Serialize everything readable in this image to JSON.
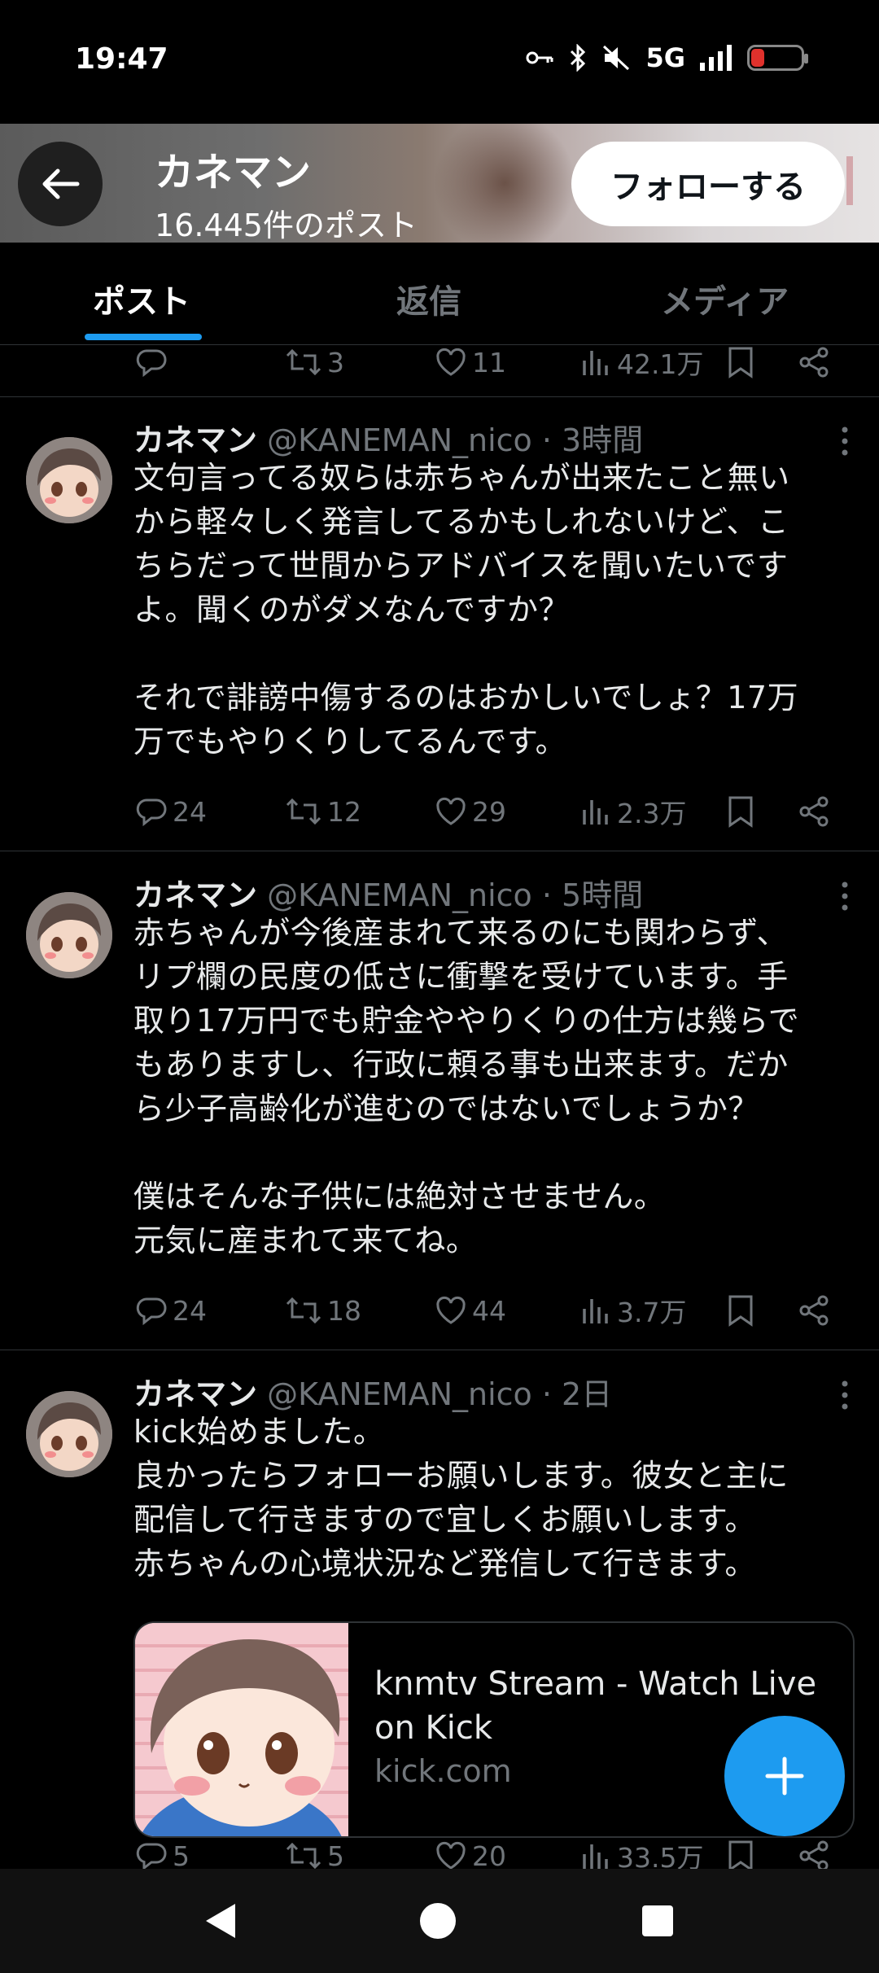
{
  "status_bar": {
    "time": "19:47",
    "network": "5G"
  },
  "header": {
    "name": "カネマン",
    "post_count": "16.445件のポスト",
    "follow_label": "フォローする"
  },
  "tabs": [
    {
      "label": "ポスト"
    },
    {
      "label": "返信"
    },
    {
      "label": "メディア"
    }
  ],
  "partial_post": {
    "retweets": "3",
    "likes": "11",
    "views": "42.1万"
  },
  "posts": [
    {
      "name": "カネマン",
      "handle": "@KANEMAN_nico",
      "time": "3時間",
      "meta": "@KANEMAN_nico · 3時間",
      "text": "文句言ってる奴らは赤ちゃんが出来たこと無い\nから軽々しく発言してるかもしれないけど、こ\nちらだって世間からアドバイスを聞いたいです\nよ。聞くのがダメなんですか？\n\nそれで誹謗中傷するのはおかしいでしょ？17万\n万でもやりくりしてるんです。",
      "replies": "24",
      "retweets": "12",
      "likes": "29",
      "views": "2.3万"
    },
    {
      "name": "カネマン",
      "handle": "@KANEMAN_nico",
      "time": "5時間",
      "meta": "@KANEMAN_nico · 5時間",
      "text": "赤ちゃんが今後産まれて来るのにも関わらず、\nリプ欄の民度の低さに衝撃を受けています。手\n取り17万円でも貯金ややりくりの仕方は幾らで\nもありますし、行政に頼る事も出来ます。だか\nら少子高齢化が進むのではないでしょうか？\n\n僕はそんな子供には絶対させません。\n元気に産まれて来てね。",
      "replies": "24",
      "retweets": "18",
      "likes": "44",
      "views": "3.7万"
    },
    {
      "name": "カネマン",
      "handle": "@KANEMAN_nico",
      "time": "2日",
      "meta": "@KANEMAN_nico · 2日",
      "text": "kick始めました。\n良かったらフォローお願いします。彼女と主に\n配信して行きますので宜しくお願いします。\n赤ちゃんの心境状況など発信して行きます。",
      "card": {
        "title": "knmtv Stream - Watch Live on Kick",
        "domain": "kick.com"
      },
      "replies": "5",
      "retweets": "5",
      "likes": "20",
      "views": "33.5万"
    }
  ],
  "colors": {
    "accent": "#1d9bf0",
    "background": "#000000",
    "text": "#e7e9ea",
    "muted": "#71767b",
    "divider": "#2f3336"
  },
  "icons": [
    "back-arrow-icon",
    "reply-icon",
    "retweet-icon",
    "like-icon",
    "views-icon",
    "bookmark-icon",
    "share-icon",
    "more-icon",
    "compose-plus-icon"
  ]
}
